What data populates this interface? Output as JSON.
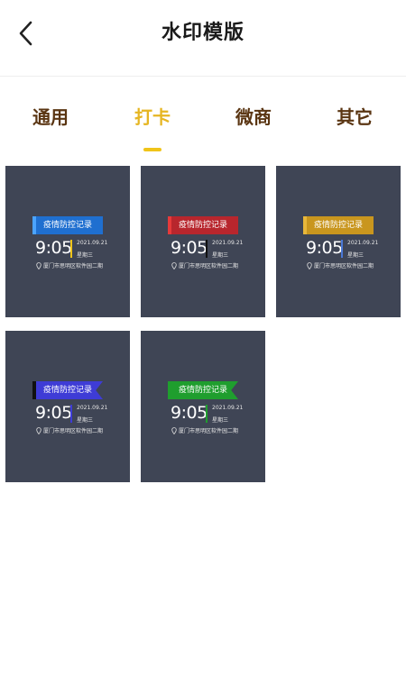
{
  "header": {
    "title": "水印模版",
    "back_icon": "chevron-left-icon"
  },
  "tabs": [
    {
      "label": "通用",
      "active": false
    },
    {
      "label": "打卡",
      "active": true
    },
    {
      "label": "微商",
      "active": false
    },
    {
      "label": "其它",
      "active": false
    }
  ],
  "colors": {
    "accent": "#f0c419",
    "tab_text": "#5a3512",
    "card_bg": "#3f4555"
  },
  "templates": [
    {
      "title": "疫情防控记录",
      "time": "9:05",
      "date": "2021.09.21",
      "weekday": "星期三",
      "location": "厦门市思明区软件园二期",
      "banner_color": "#1f6fd0",
      "edge_color": "#4ba3ff",
      "bar_color": "#f0c419"
    },
    {
      "title": "疫情防控记录",
      "time": "9:05",
      "date": "2021.09.21",
      "weekday": "星期三",
      "location": "厦门市思明区软件园二期",
      "banner_color": "#b8262d",
      "edge_color": "#e63a3a",
      "bar_color": "#111111"
    },
    {
      "title": "疫情防控记录",
      "time": "9:05",
      "date": "2021.09.21",
      "weekday": "星期三",
      "location": "厦门市思明区软件园二期",
      "banner_color": "#c9961e",
      "edge_color": "#e8b73a",
      "bar_color": "#4a78d6"
    },
    {
      "title": "疫情防控记录",
      "time": "9:05",
      "date": "2021.09.21",
      "weekday": "星期三",
      "location": "厦门市思明区软件园二期",
      "banner_color": "#3e3cd6",
      "edge_color": "#111111",
      "bar_color": "#3e3cd6"
    },
    {
      "title": "疫情防控记录",
      "time": "9:05",
      "date": "2021.09.21",
      "weekday": "星期三",
      "location": "厦门市思明区软件园二期",
      "banner_color": "#1f9e2e",
      "edge_color": "#1f9e2e",
      "bar_color": "#1f9e2e"
    }
  ]
}
